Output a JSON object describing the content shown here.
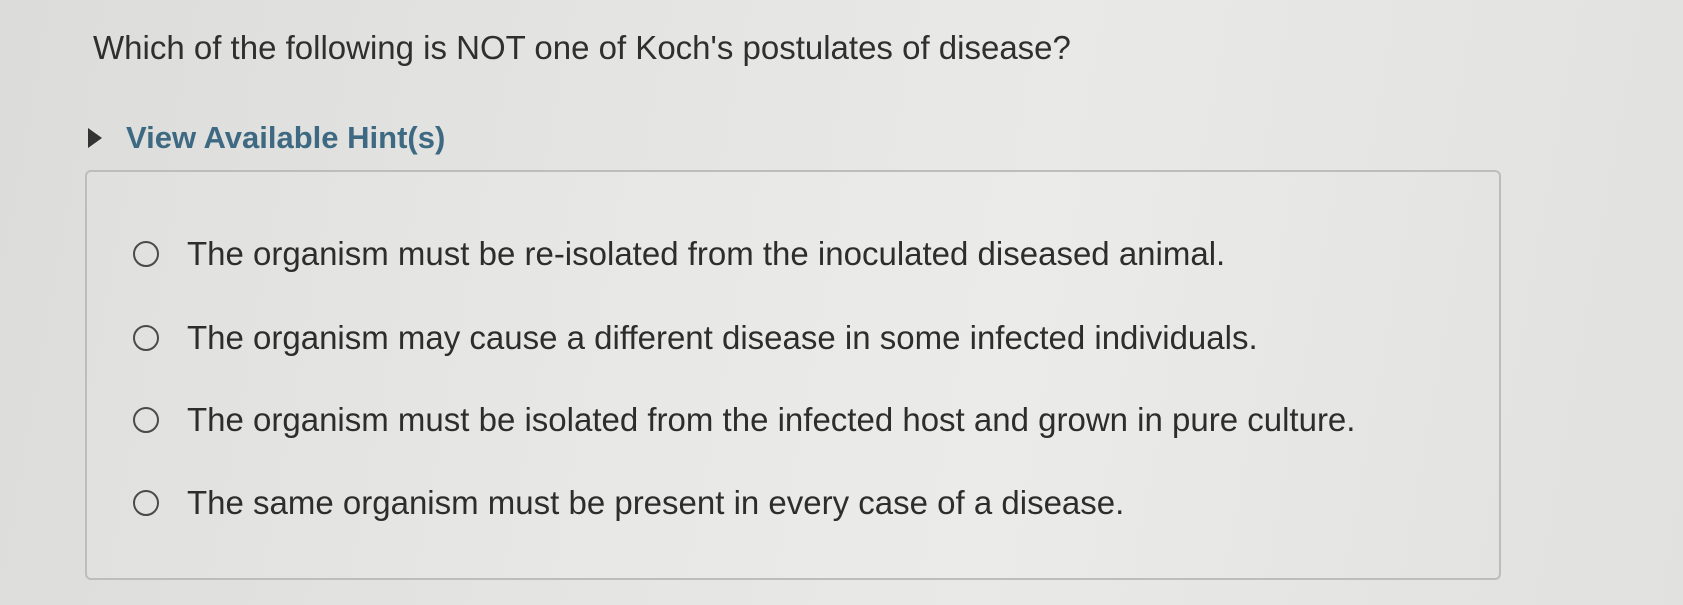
{
  "question": {
    "text": "Which of the following is NOT one of Koch's postulates of disease?"
  },
  "hint": {
    "label": "View Available Hint(s)",
    "icon": "caret-right-icon",
    "color": "#3d6a82"
  },
  "options": [
    {
      "label": "The organism must be re-isolated from the inoculated diseased animal.",
      "selected": false
    },
    {
      "label": "The organism may cause a different disease in some infected individuals.",
      "selected": false
    },
    {
      "label": "The organism must be isolated from the infected host and grown in pure culture.",
      "selected": false
    },
    {
      "label": "The same organism must be present in every case of a disease.",
      "selected": false
    }
  ]
}
